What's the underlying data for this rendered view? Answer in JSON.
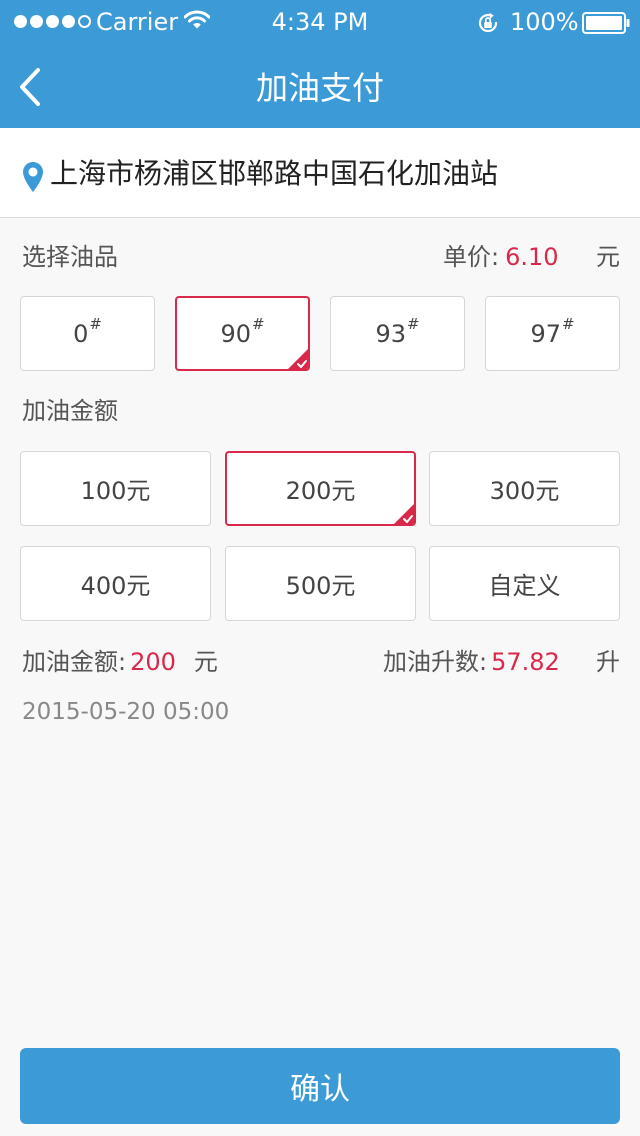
{
  "status_bar": {
    "carrier": "Carrier",
    "time": "4:34 PM",
    "battery": "100%",
    "signal_dots_filled": 4,
    "signal_dots_total": 5
  },
  "nav": {
    "title": "加油支付",
    "back_icon": "chevron-left-icon"
  },
  "station": {
    "pin_icon": "location-pin-icon",
    "address": "上海市杨浦区邯郸路中国石化加油站"
  },
  "fuel": {
    "label": "选择油品",
    "unit_price_label": "单价:",
    "unit_price": "6.10",
    "unit_price_currency": "元",
    "options": [
      {
        "value": "0",
        "mark": "#",
        "selected": false
      },
      {
        "value": "90",
        "mark": "#",
        "selected": true
      },
      {
        "value": "93",
        "mark": "#",
        "selected": false
      },
      {
        "value": "97",
        "mark": "#",
        "selected": false
      }
    ]
  },
  "amount": {
    "label": "加油金额",
    "options": [
      {
        "label": "100元",
        "selected": false
      },
      {
        "label": "200元",
        "selected": true
      },
      {
        "label": "300元",
        "selected": false
      },
      {
        "label": "400元",
        "selected": false
      },
      {
        "label": "500元",
        "selected": false
      },
      {
        "label": "自定义",
        "selected": false
      }
    ]
  },
  "summary": {
    "amount_label": "加油金额:",
    "amount_value": "200",
    "amount_unit": "元",
    "liters_label": "加油升数:",
    "liters_value": "57.82",
    "liters_unit": "升",
    "datetime": "2015-05-20  05:00"
  },
  "confirm_button": "确认",
  "colors": {
    "brand_blue": "#3c9bd6",
    "accent_red": "#d8294a",
    "background": "#f8f8f8"
  }
}
